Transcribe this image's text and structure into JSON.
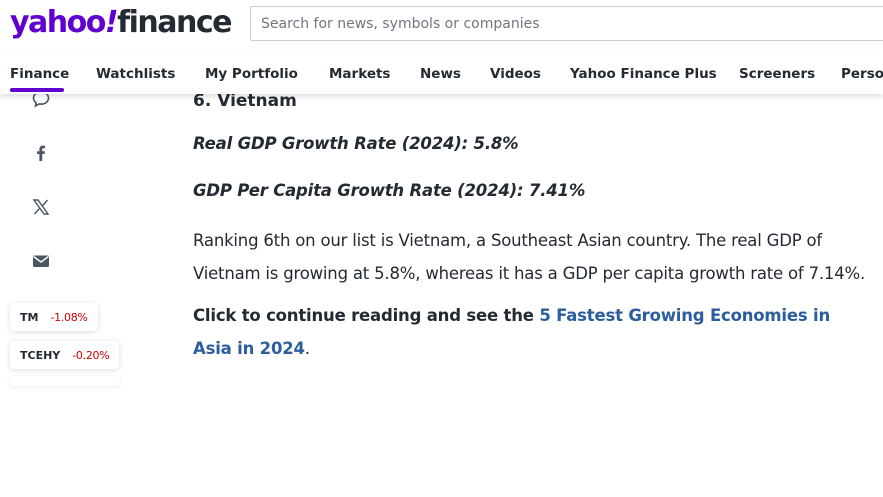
{
  "header": {
    "logo_yahoo": "yahoo",
    "logo_slash": "!",
    "logo_finance": "finance",
    "search_placeholder": "Search for news, symbols or companies",
    "brand_color": "#6001d2"
  },
  "nav": {
    "items": [
      {
        "label": "Finance",
        "active": true
      },
      {
        "label": "Watchlists"
      },
      {
        "label": "My Portfolio"
      },
      {
        "label": "Markets"
      },
      {
        "label": "News"
      },
      {
        "label": "Videos"
      },
      {
        "label": "Yahoo Finance Plus"
      },
      {
        "label": "Screeners"
      },
      {
        "label": "Perso"
      }
    ]
  },
  "share": {
    "icons": [
      "comment-icon",
      "facebook-icon",
      "x-icon",
      "email-icon"
    ]
  },
  "tickers": [
    {
      "symbol": "TM",
      "change": "-1.08%"
    },
    {
      "symbol": "TCEHY",
      "change": "-0.20%"
    }
  ],
  "article": {
    "heading": "6. Vietnam",
    "stat_real_gdp": "Real GDP Growth Rate (2024): 5.8%",
    "stat_gdp_per_capita": "GDP Per Capita Growth Rate (2024): 7.41%",
    "paragraph": "Ranking 6th on our list is Vietnam, a Southeast Asian country. The real GDP of Vietnam is growing at 5.8%, whereas it has a GDP per capita growth rate of 7.14%.",
    "cta_text": "Click to continue reading and see the ",
    "cta_link": "5 Fastest Growing Economies in Asia in 2024",
    "cta_end": ".",
    "link_color": "#2c5d9c",
    "negative_color": "#cc0000"
  }
}
